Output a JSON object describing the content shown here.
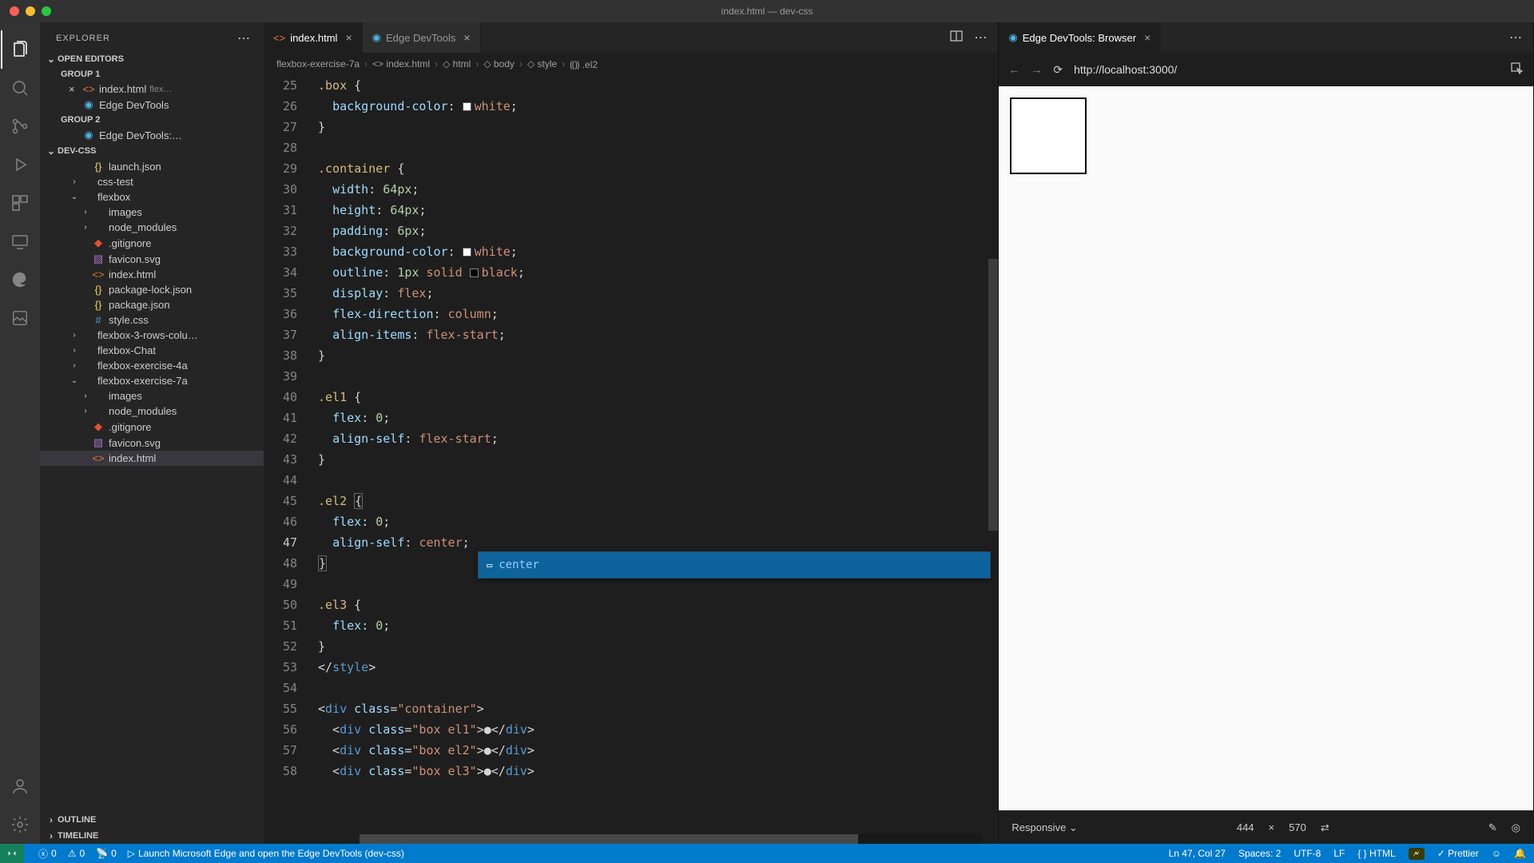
{
  "window": {
    "title": "index.html — dev-css"
  },
  "explorer": {
    "title": "EXPLORER",
    "sections": {
      "open_editors": "OPEN EDITORS",
      "group1": "GROUP 1",
      "group2": "GROUP 2",
      "project": "DEV-CSS",
      "outline": "OUTLINE",
      "timeline": "TIMELINE"
    },
    "open_editors": {
      "group1": [
        {
          "label": "index.html",
          "hint": "flex…",
          "icon": "html",
          "dirty": false,
          "closable": true
        },
        {
          "label": "Edge DevTools",
          "icon": "edge"
        }
      ],
      "group2": [
        {
          "label": "Edge DevTools:…",
          "icon": "edge"
        }
      ]
    },
    "tree": [
      {
        "label": "launch.json",
        "icon": "json",
        "depth": 1
      },
      {
        "label": "css-test",
        "icon": "folder",
        "depth": 0,
        "chev": "›"
      },
      {
        "label": "flexbox",
        "icon": "folder",
        "depth": 0,
        "chev": "⌄"
      },
      {
        "label": "images",
        "icon": "folder",
        "depth": 1,
        "chev": "›"
      },
      {
        "label": "node_modules",
        "icon": "folder",
        "depth": 1,
        "chev": "›"
      },
      {
        "label": ".gitignore",
        "icon": "git",
        "depth": 1
      },
      {
        "label": "favicon.svg",
        "icon": "svg",
        "depth": 1
      },
      {
        "label": "index.html",
        "icon": "html",
        "depth": 1
      },
      {
        "label": "package-lock.json",
        "icon": "json",
        "depth": 1
      },
      {
        "label": "package.json",
        "icon": "json",
        "depth": 1
      },
      {
        "label": "style.css",
        "icon": "css",
        "depth": 1
      },
      {
        "label": "flexbox-3-rows-colu…",
        "icon": "folder",
        "depth": 0,
        "chev": "›"
      },
      {
        "label": "flexbox-Chat",
        "icon": "folder",
        "depth": 0,
        "chev": "›"
      },
      {
        "label": "flexbox-exercise-4a",
        "icon": "folder",
        "depth": 0,
        "chev": "›"
      },
      {
        "label": "flexbox-exercise-7a",
        "icon": "folder",
        "depth": 0,
        "chev": "⌄"
      },
      {
        "label": "images",
        "icon": "folder",
        "depth": 1,
        "chev": "›"
      },
      {
        "label": "node_modules",
        "icon": "folder",
        "depth": 1,
        "chev": "›"
      },
      {
        "label": ".gitignore",
        "icon": "git",
        "depth": 1
      },
      {
        "label": "favicon.svg",
        "icon": "svg",
        "depth": 1
      },
      {
        "label": "index.html",
        "icon": "html",
        "depth": 1,
        "selected": true
      }
    ]
  },
  "tabs_left": [
    {
      "label": "index.html",
      "icon": "html",
      "active": true
    },
    {
      "label": "Edge DevTools",
      "icon": "edge",
      "active": false
    }
  ],
  "tabs_right": [
    {
      "label": "Edge DevTools: Browser",
      "icon": "edge",
      "active": true
    }
  ],
  "breadcrumbs": [
    "flexbox-exercise-7a",
    "index.html",
    "html",
    "body",
    "style",
    ".el2"
  ],
  "gutter_start": 25,
  "code_lines": [
    {
      "n": 25,
      "html": "<span class='tok-sel'>.box</span> {"
    },
    {
      "n": 26,
      "html": "  <span class='tok-prop'>background-color</span>: <span class='color-swatch sw-white'></span><span class='tok-val'>white</span>;"
    },
    {
      "n": 27,
      "html": "}"
    },
    {
      "n": 28,
      "html": ""
    },
    {
      "n": 29,
      "html": "<span class='tok-sel'>.container</span> {"
    },
    {
      "n": 30,
      "html": "  <span class='tok-prop'>width</span>: <span class='tok-num'>64px</span>;"
    },
    {
      "n": 31,
      "html": "  <span class='tok-prop'>height</span>: <span class='tok-num'>64px</span>;"
    },
    {
      "n": 32,
      "html": "  <span class='tok-prop'>padding</span>: <span class='tok-num'>6px</span>;"
    },
    {
      "n": 33,
      "html": "  <span class='tok-prop'>background-color</span>: <span class='color-swatch sw-white'></span><span class='tok-val'>white</span>;"
    },
    {
      "n": 34,
      "html": "  <span class='tok-prop'>outline</span>: <span class='tok-num'>1px</span> <span class='tok-val'>solid</span> <span class='color-swatch sw-black'></span><span class='tok-val'>black</span>;"
    },
    {
      "n": 35,
      "html": "  <span class='tok-prop'>display</span>: <span class='tok-val'>flex</span>;"
    },
    {
      "n": 36,
      "html": "  <span class='tok-prop'>flex-direction</span>: <span class='tok-val'>column</span>;"
    },
    {
      "n": 37,
      "html": "  <span class='tok-prop'>align-items</span>: <span class='tok-val'>flex-start</span>;"
    },
    {
      "n": 38,
      "html": "}"
    },
    {
      "n": 39,
      "html": ""
    },
    {
      "n": 40,
      "html": "<span class='tok-sel'>.el1</span> {"
    },
    {
      "n": 41,
      "html": "  <span class='tok-prop'>flex</span>: <span class='tok-num'>0</span>;"
    },
    {
      "n": 42,
      "html": "  <span class='tok-prop'>align-self</span>: <span class='tok-val'>flex-start</span>;"
    },
    {
      "n": 43,
      "html": "}"
    },
    {
      "n": 44,
      "html": ""
    },
    {
      "n": 45,
      "html": "<span class='tok-sel'>.el2</span> <span class='bracket-hl'>{</span>"
    },
    {
      "n": 46,
      "html": "  <span class='tok-prop'>flex</span>: <span class='tok-num'>0</span>;"
    },
    {
      "n": 47,
      "html": "  <span class='tok-prop'>align-self</span>: <span class='tok-val'>center</span>;",
      "current": true
    },
    {
      "n": 48,
      "html": "<span class='bracket-hl'>}</span>"
    },
    {
      "n": 49,
      "html": ""
    },
    {
      "n": 50,
      "html": "<span class='tok-sel'>.el3</span> {"
    },
    {
      "n": 51,
      "html": "  <span class='tok-prop'>flex</span>: <span class='tok-num'>0</span>;"
    },
    {
      "n": 52,
      "html": "}"
    },
    {
      "n": 53,
      "html": "&lt;/<span class='tok-tag'>style</span>&gt;"
    },
    {
      "n": 54,
      "html": ""
    },
    {
      "n": 55,
      "html": "&lt;<span class='tok-tag'>div</span> <span class='tok-attr'>class</span>=<span class='tok-val'>\"container\"</span>&gt;"
    },
    {
      "n": 56,
      "html": "  &lt;<span class='tok-tag'>div</span> <span class='tok-attr'>class</span>=<span class='tok-val'>\"box el1\"</span>&gt;●&lt;/<span class='tok-tag'>div</span>&gt;"
    },
    {
      "n": 57,
      "html": "  &lt;<span class='tok-tag'>div</span> <span class='tok-attr'>class</span>=<span class='tok-val'>\"box el2\"</span>&gt;●&lt;/<span class='tok-tag'>div</span>&gt;"
    },
    {
      "n": 58,
      "html": "  &lt;<span class='tok-tag'>div</span> <span class='tok-attr'>class</span>=<span class='tok-val'>\"box el3\"</span>&gt;●&lt;/<span class='tok-tag'>div</span>&gt;"
    }
  ],
  "suggest": {
    "label": "center"
  },
  "browser": {
    "url": "http://localhost:3000/",
    "device": "Responsive",
    "width": "444",
    "height": "570"
  },
  "status": {
    "errors": "0",
    "warnings": "0",
    "port": "0",
    "launch_hint": "Launch Microsoft Edge and open the Edge DevTools (dev-css)",
    "cursor": "Ln 47, Col 27",
    "spaces": "Spaces: 2",
    "encoding": "UTF-8",
    "eol": "LF",
    "lang": "HTML",
    "prettier": "Prettier"
  }
}
